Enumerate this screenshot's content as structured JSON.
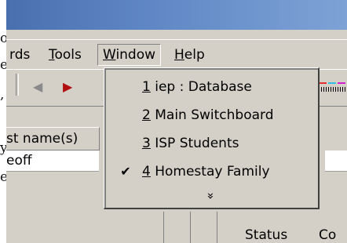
{
  "doc": {
    "glyphs": [
      "o",
      "e",
      ",",
      "y",
      "e"
    ]
  },
  "menubar": {
    "items": [
      "rds",
      "Tools",
      "Window",
      "Help"
    ],
    "open_index": 2
  },
  "toolbar": {
    "back_icon": "triangle-left",
    "forward_icon": "triangle-right"
  },
  "window_menu": {
    "items": [
      {
        "number": "1",
        "label": " iep : Database",
        "checked": false
      },
      {
        "number": "2",
        "label": " Main Switchboard",
        "checked": false
      },
      {
        "number": "3",
        "label": " ISP Students",
        "checked": false
      },
      {
        "number": "4",
        "label": " Homestay Family",
        "checked": true
      }
    ],
    "more_glyph": "»",
    "check_glyph": "✔"
  },
  "datasheet": {
    "column_header": "st name(s)",
    "cell_value": "eoff",
    "status_label": "Status",
    "status_right": "Co"
  }
}
